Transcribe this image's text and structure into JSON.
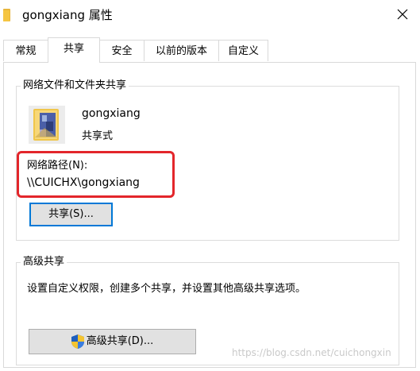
{
  "window": {
    "title": "gongxiang 属性",
    "close_glyph": "✕"
  },
  "tabs": [
    {
      "label": "常规",
      "active": false
    },
    {
      "label": "共享",
      "active": true
    },
    {
      "label": "安全",
      "active": false
    },
    {
      "label": "以前的版本",
      "active": false
    },
    {
      "label": "自定义",
      "active": false
    }
  ],
  "network_share": {
    "group_title": "网络文件和文件夹共享",
    "share_name": "gongxiang",
    "share_type": "共享式",
    "network_path_label": "网络路径(N):",
    "network_path_value": "\\\\CUICHX\\gongxiang",
    "share_button": "共享(S)..."
  },
  "advanced_share": {
    "group_title": "高级共享",
    "description": "设置自定义权限，创建多个共享，并设置其他高级共享选项。",
    "button": "高级共享(D)..."
  },
  "annotation": {
    "highlight_color": "#e3262b"
  },
  "colors": {
    "accent": "#0078d7",
    "folder": "#f5c542"
  },
  "icons": {
    "title": "folder-icon",
    "share": "shared-folder-icon",
    "advanced_button": "uac-shield-icon",
    "close": "close-icon"
  },
  "watermark": "https://blog.csdn.net/cuichongxin"
}
